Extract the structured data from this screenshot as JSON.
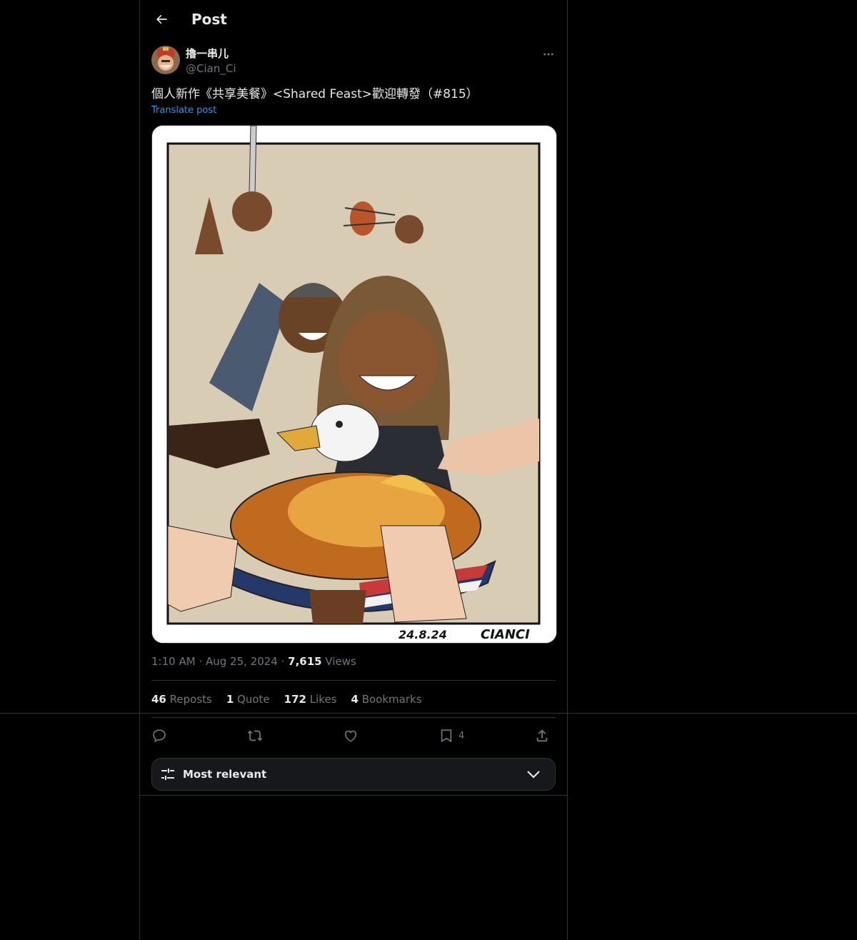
{
  "header": {
    "title": "Post",
    "back_icon": "arrow-left-icon"
  },
  "author": {
    "display_name": "擼一串儿",
    "handle": "@Cian_Ci"
  },
  "post": {
    "text": "個人新作《共享美餐》<Shared Feast>歡迎轉發（#815）",
    "translate_label": "Translate post",
    "image": {
      "signature": "CIANCI",
      "date": "24.8.24"
    }
  },
  "meta": {
    "time": "1:10 AM",
    "date": "Aug 25, 2024",
    "views_count": "7,615",
    "views_label": "Views"
  },
  "stats": {
    "reposts_count": "46",
    "reposts_label": "Reposts",
    "quotes_count": "1",
    "quotes_label": "Quote",
    "likes_count": "172",
    "likes_label": "Likes",
    "bookmarks_count": "4",
    "bookmarks_label": "Bookmarks"
  },
  "actions": {
    "bookmark_count": "4"
  },
  "sort": {
    "label": "Most relevant"
  },
  "colors": {
    "background": "#000000",
    "border": "#2f3336",
    "muted": "#71767b",
    "link": "#1d9bf0",
    "text": "#e7e9ea"
  }
}
